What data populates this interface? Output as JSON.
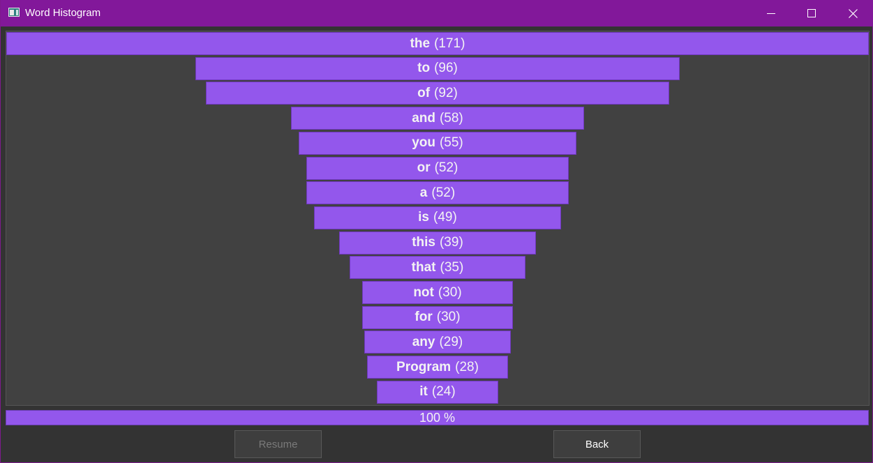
{
  "window": {
    "title": "Word Histogram",
    "colors": {
      "titlebar": "#82189a",
      "bar": "#9357ec",
      "background": "#414141"
    }
  },
  "chart_data": {
    "type": "bar",
    "orientation": "horizontal-centered",
    "categories": [
      "the",
      "to",
      "of",
      "and",
      "you",
      "or",
      "a",
      "is",
      "this",
      "that",
      "not",
      "for",
      "any",
      "Program",
      "it"
    ],
    "values": [
      171,
      96,
      92,
      58,
      55,
      52,
      52,
      49,
      39,
      35,
      30,
      30,
      29,
      28,
      24
    ],
    "count_labels": [
      "(171)",
      "(96)",
      "(92)",
      "(58)",
      "(55)",
      "(52)",
      "(52)",
      "(49)",
      "(39)",
      "(35)",
      "(30)",
      "(30)",
      "(29)",
      "(28)",
      "(24)"
    ],
    "color": "#9357ec"
  },
  "progress": {
    "value": 100,
    "label": "100 %"
  },
  "buttons": {
    "resume_label": "Resume",
    "back_label": "Back"
  },
  "icons": {
    "app": "window-app-icon",
    "minimize": "minimize-icon",
    "maximize": "maximize-icon",
    "close": "close-icon"
  }
}
